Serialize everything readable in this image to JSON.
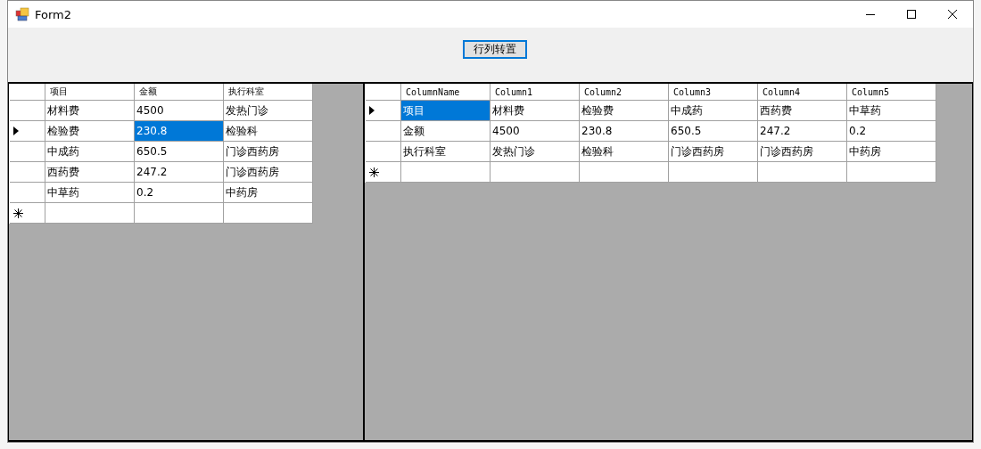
{
  "window": {
    "title": "Form2"
  },
  "toolbar": {
    "button": "行列转置"
  },
  "grids": [
    {
      "columns": [
        "项目",
        "金额",
        "执行科室"
      ],
      "rows": [
        {
          "kind": "data",
          "current": false,
          "cells": [
            {
              "text": "材料费",
              "selected": false
            },
            {
              "text": "4500",
              "selected": false
            },
            {
              "text": "发热门诊",
              "selected": false
            }
          ]
        },
        {
          "kind": "data",
          "current": true,
          "cells": [
            {
              "text": "检验费",
              "selected": false
            },
            {
              "text": "230.8",
              "selected": true
            },
            {
              "text": "检验科",
              "selected": false
            }
          ]
        },
        {
          "kind": "data",
          "current": false,
          "cells": [
            {
              "text": "中成药",
              "selected": false
            },
            {
              "text": "650.5",
              "selected": false
            },
            {
              "text": "门诊西药房",
              "selected": false
            }
          ]
        },
        {
          "kind": "data",
          "current": false,
          "cells": [
            {
              "text": "西药费",
              "selected": false
            },
            {
              "text": "247.2",
              "selected": false
            },
            {
              "text": "门诊西药房",
              "selected": false
            }
          ]
        },
        {
          "kind": "data",
          "current": false,
          "cells": [
            {
              "text": "中草药",
              "selected": false
            },
            {
              "text": "0.2",
              "selected": false
            },
            {
              "text": "中药房",
              "selected": false
            }
          ]
        },
        {
          "kind": "new",
          "cells": []
        }
      ]
    },
    {
      "columns": [
        "ColumnName",
        "Column1",
        "Column2",
        "Column3",
        "Column4",
        "Column5"
      ],
      "rows": [
        {
          "kind": "data",
          "current": true,
          "cells": [
            {
              "text": "项目",
              "selected": true
            },
            {
              "text": "材料费",
              "selected": false
            },
            {
              "text": "检验费",
              "selected": false
            },
            {
              "text": "中成药",
              "selected": false
            },
            {
              "text": "西药费",
              "selected": false
            },
            {
              "text": "中草药",
              "selected": false
            }
          ]
        },
        {
          "kind": "data",
          "current": false,
          "cells": [
            {
              "text": "金额",
              "selected": false
            },
            {
              "text": "4500",
              "selected": false
            },
            {
              "text": "230.8",
              "selected": false
            },
            {
              "text": "650.5",
              "selected": false
            },
            {
              "text": "247.2",
              "selected": false
            },
            {
              "text": "0.2",
              "selected": false
            }
          ]
        },
        {
          "kind": "data",
          "current": false,
          "cells": [
            {
              "text": "执行科室",
              "selected": false
            },
            {
              "text": "发热门诊",
              "selected": false
            },
            {
              "text": "检验科",
              "selected": false
            },
            {
              "text": "门诊西药房",
              "selected": false
            },
            {
              "text": "门诊西药房",
              "selected": false
            },
            {
              "text": "中药房",
              "selected": false
            }
          ]
        },
        {
          "kind": "new",
          "cells": []
        }
      ]
    }
  ]
}
